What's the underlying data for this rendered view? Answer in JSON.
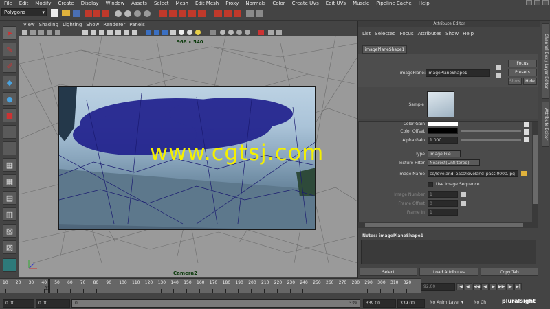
{
  "menubar": {
    "items": [
      "File",
      "Edit",
      "Modify",
      "Create",
      "Display",
      "Window",
      "Assets",
      "Select",
      "Mesh",
      "Edit Mesh",
      "Proxy",
      "Normals",
      "Color",
      "Create UVs",
      "Edit UVs",
      "Muscle",
      "Pipeline Cache",
      "Help"
    ]
  },
  "statusline": {
    "mode": "Polygons"
  },
  "viewport": {
    "menu": [
      "View",
      "Shading",
      "Lighting",
      "Show",
      "Renderer",
      "Panels"
    ],
    "resolution": "968 x 540",
    "camera": "Camera2",
    "watermark": "www.cgtsj.com"
  },
  "attribute_editor": {
    "title": "Attribute Editor",
    "menu": [
      "List",
      "Selected",
      "Focus",
      "Attributes",
      "Show",
      "Help"
    ],
    "tab": "imagePlaneShape1",
    "image_plane_label": "imagePlane:",
    "image_plane_value": "imagePlaneShape1",
    "focus_btn": "Focus",
    "presets_btn": "Presets",
    "show_btn": "Show",
    "hide_btn": "Hide",
    "sample_label": "Sample",
    "attrs": {
      "color_gain_label": "Color Gain",
      "color_offset_label": "Color Offset",
      "alpha_gain_label": "Alpha Gain",
      "alpha_gain_value": "1.000",
      "type_label": "Type",
      "type_value": "Image File",
      "texture_filter_label": "Texture Filter",
      "texture_filter_value": "Nearest(Unfiltered)",
      "image_name_label": "Image Name",
      "image_name_value": "ce/loveland_pass/loveland_pass.0000.jpg",
      "use_sequence_label": "Use Image Sequence",
      "image_number_label": "Image Number",
      "image_number_value": "1",
      "frame_offset_label": "Frame Offset",
      "frame_offset_value": "0",
      "frame_in_label": "Frame In",
      "frame_in_value": "1"
    },
    "notes_label": "Notes: imagePlaneShape1",
    "footer": {
      "select": "Select",
      "load": "Load Attributes",
      "copy": "Copy Tab"
    }
  },
  "vtabs": {
    "channel_box": "Channel Box / Layer Editor",
    "attribute_editor": "Attribute Editor"
  },
  "timeslider": {
    "ticks": [
      "10",
      "20",
      "30",
      "40",
      "50",
      "60",
      "70",
      "80",
      "90",
      "100",
      "110",
      "120",
      "130",
      "140",
      "150",
      "160",
      "170",
      "180",
      "190",
      "200",
      "210",
      "220",
      "230",
      "240",
      "250",
      "260",
      "270",
      "280",
      "290",
      "300",
      "310",
      "320"
    ],
    "current_frame": "33",
    "current_time_field": "92.00"
  },
  "playback": [
    "|◀",
    "◀|",
    "◀◀",
    "◀",
    "▶",
    "▶▶",
    "|▶",
    "▶|"
  ],
  "range": {
    "start": "0.00",
    "anim_start": "0.00",
    "range_start": "0",
    "range_end": "339",
    "anim_end": "339.00",
    "end": "339.00",
    "anim_layer": "No Anim Layer",
    "char_set": "No Ch"
  },
  "brand": "pluralsight",
  "colors": {
    "accent_red": "#c0392b",
    "viewport_bg": "#9a9a9a",
    "mesh_blue": "#1e1e8c",
    "watermark": "#f4f000"
  }
}
